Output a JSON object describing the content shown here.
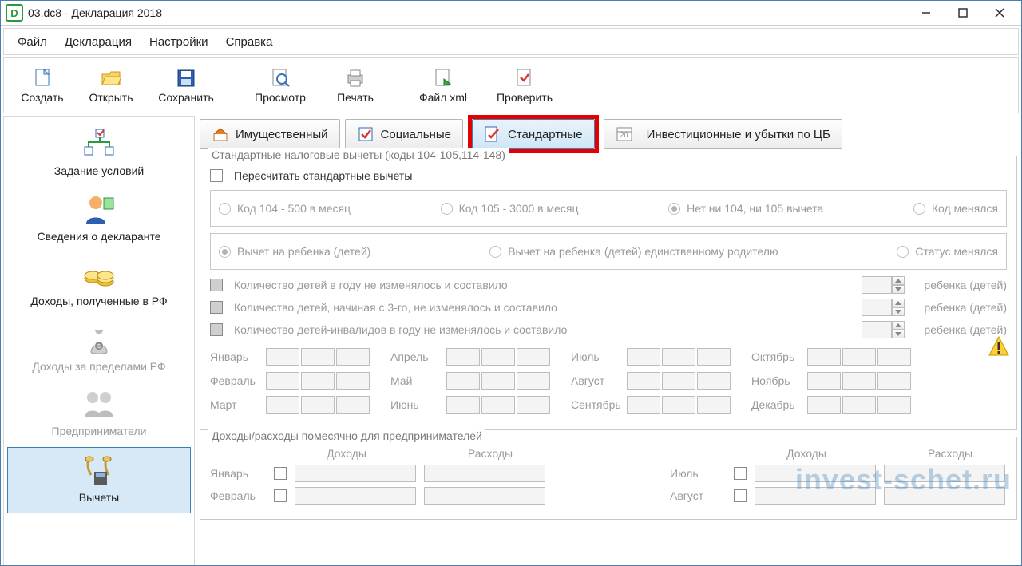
{
  "window": {
    "title": "03.dc8 - Декларация 2018"
  },
  "menu": {
    "file": "Файл",
    "declaration": "Декларация",
    "settings": "Настройки",
    "help": "Справка"
  },
  "toolbar": {
    "create": "Создать",
    "open": "Открыть",
    "save": "Сохранить",
    "preview": "Просмотр",
    "print": "Печать",
    "filexml": "Файл xml",
    "check": "Проверить"
  },
  "sidebar": {
    "conditions": "Задание условий",
    "declarant": "Сведения о декларанте",
    "income_rf": "Доходы, полученные в РФ",
    "income_abroad": "Доходы за пределами РФ",
    "entrepreneurs": "Предприниматели",
    "deductions": "Вычеты"
  },
  "tabs": {
    "property": "Имущественный",
    "social": "Социальные",
    "standard": "Стандартные",
    "invest": "Инвестиционные и убытки по ЦБ",
    "invest_badge": "20.."
  },
  "std": {
    "group_title": "Стандартные налоговые вычеты (коды 104-105,114-148)",
    "recalc": "Пересчитать стандартные вычеты",
    "code104": "Код 104 - 500 в месяц",
    "code105": "Код 105 - 3000 в месяц",
    "none": "Нет ни 104, ни 105 вычета",
    "code_changed": "Код менялся",
    "child": "Вычет на ребенка (детей)",
    "child_single": "Вычет на ребенка (детей) единственному родителю",
    "status_changed": "Статус менялся",
    "kids_count": "Количество детей в году не изменялось и составило",
    "kids_from3": "Количество детей, начиная с 3-го, не изменялось и составило",
    "kids_disabled": "Количество детей-инвалидов в году не изменялось и составило",
    "suffix": "ребенка (детей)",
    "months": {
      "jan": "Январь",
      "feb": "Февраль",
      "mar": "Март",
      "apr": "Апрель",
      "may": "Май",
      "jun": "Июнь",
      "jul": "Июль",
      "aug": "Август",
      "sep": "Сентябрь",
      "oct": "Октябрь",
      "nov": "Ноябрь",
      "dec": "Декабрь"
    }
  },
  "entr": {
    "group_title": "Доходы/расходы помесячно для предпринимателей",
    "income": "Доходы",
    "expense": "Расходы",
    "jan": "Январь",
    "feb": "Февраль",
    "jul": "Июль",
    "aug": "Август"
  },
  "watermark": "invest-schet.ru"
}
